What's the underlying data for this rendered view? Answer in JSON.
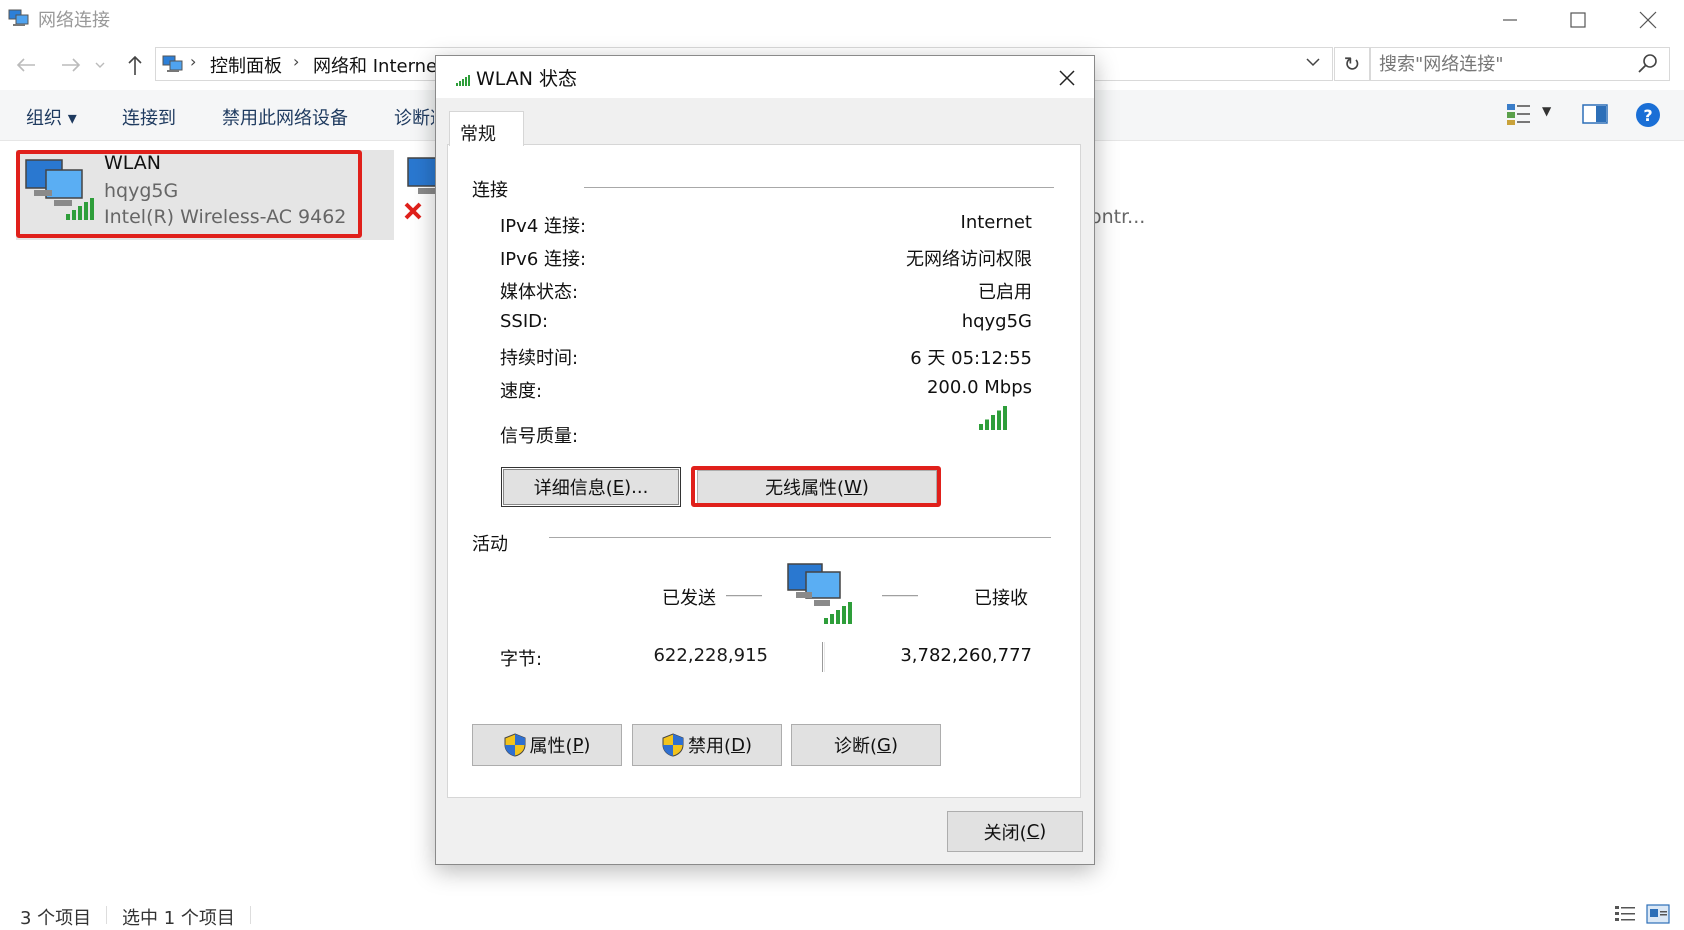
{
  "window": {
    "title": "网络连接",
    "breadcrumb": [
      "控制面板",
      "网络和 Internet"
    ],
    "search_placeholder": "搜索\"网络连接\""
  },
  "toolbar": {
    "organize": "组织 ▾",
    "connect_to": "连接到",
    "disable_device": "禁用此网络设备",
    "diagnose": "诊断这"
  },
  "items": {
    "wlan": {
      "name": "WLAN",
      "ssid": "hqyg5G",
      "adapter": "Intel(R) Wireless-AC 9462"
    },
    "third_adapter_partial": "ontr..."
  },
  "statusbar": {
    "count": "3 个项目",
    "selected": "选中 1 个项目"
  },
  "dialog": {
    "title": "WLAN 状态",
    "tab": "常规",
    "connection": {
      "group": "连接",
      "rows": [
        {
          "label": "IPv4 连接:",
          "value": "Internet"
        },
        {
          "label": "IPv6 连接:",
          "value": "无网络访问权限"
        },
        {
          "label": "媒体状态:",
          "value": "已启用"
        },
        {
          "label": "SSID:",
          "value": "hqyg5G"
        },
        {
          "label": "持续时间:",
          "value": "6 天 05:12:55"
        },
        {
          "label": "速度:",
          "value": "200.0 Mbps"
        }
      ],
      "signal_label": "信号质量:",
      "signal_bars": 5,
      "details_button": {
        "text": "详细信息(",
        "key": "E",
        "suffix": ")..."
      },
      "wireless_button": {
        "text": "无线属性(",
        "key": "W",
        "suffix": ")"
      }
    },
    "activity": {
      "group": "活动",
      "sent": "已发送",
      "received": "已接收",
      "bytes_label": "字节:",
      "bytes_sent": "622,228,915",
      "bytes_received": "3,782,260,777"
    },
    "buttons": {
      "properties": {
        "text": "属性(",
        "key": "P",
        "suffix": ")"
      },
      "disable": {
        "text": "禁用(",
        "key": "D",
        "suffix": ")"
      },
      "diagnose": {
        "text": "诊断(",
        "key": "G",
        "suffix": ")"
      },
      "close": {
        "text": "关闭(",
        "key": "C",
        "suffix": ")"
      }
    }
  },
  "colors": {
    "highlight_red": "#e0201b",
    "accent_blue": "#1a6fd6",
    "signal_green": "#2e9e3a"
  }
}
